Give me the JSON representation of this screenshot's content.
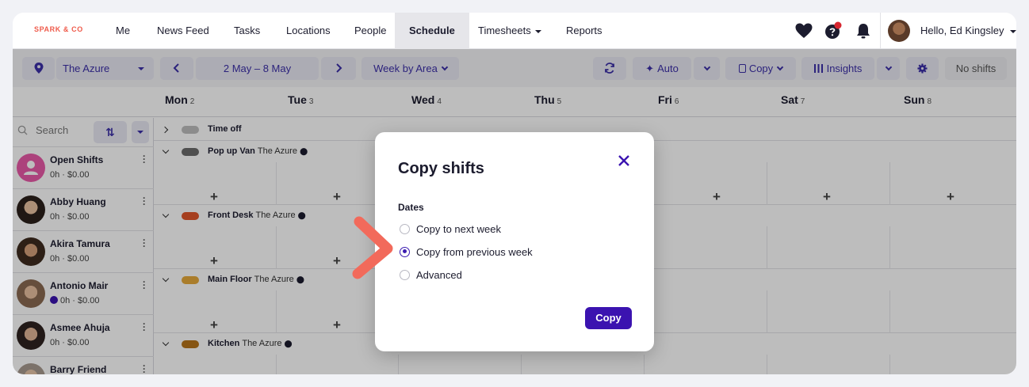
{
  "brand": "SPARK & CO",
  "nav": {
    "items": [
      {
        "label": "Me"
      },
      {
        "label": "News Feed"
      },
      {
        "label": "Tasks"
      },
      {
        "label": "Locations"
      },
      {
        "label": "People"
      },
      {
        "label": "Schedule"
      },
      {
        "label": "Timesheets"
      },
      {
        "label": "Reports"
      }
    ],
    "active": "Schedule",
    "greeting": "Hello, Ed Kingsley"
  },
  "toolbar": {
    "location": "The Azure",
    "date_range": "2 May – 8 May",
    "view": "Week by Area",
    "auto": "Auto",
    "copy": "Copy",
    "insights": "Insights",
    "no_shifts": "No shifts"
  },
  "days": [
    {
      "name": "Mon",
      "num": "2"
    },
    {
      "name": "Tue",
      "num": "3"
    },
    {
      "name": "Wed",
      "num": "4"
    },
    {
      "name": "Thu",
      "num": "5"
    },
    {
      "name": "Fri",
      "num": "6"
    },
    {
      "name": "Sat",
      "num": "7"
    },
    {
      "name": "Sun",
      "num": "8"
    }
  ],
  "sidebar": {
    "search_placeholder": "Search",
    "people": [
      {
        "name": "Open Shifts",
        "meta": "0h · $0.00"
      },
      {
        "name": "Abby Huang",
        "meta": "0h · $0.00"
      },
      {
        "name": "Akira Tamura",
        "meta": "0h · $0.00"
      },
      {
        "name": "Antonio Mair",
        "meta": "0h · $0.00"
      },
      {
        "name": "Asmee Ahuja",
        "meta": "0h · $0.00"
      },
      {
        "name": "Barry Friend",
        "meta": ""
      }
    ]
  },
  "areas": [
    {
      "name": "Time off",
      "location": "",
      "color": "#bdbdbd"
    },
    {
      "name": "Pop up Van",
      "location": "The Azure",
      "color": "#6b6b6b"
    },
    {
      "name": "Front Desk",
      "location": "The Azure",
      "color": "#e0552a"
    },
    {
      "name": "Main Floor",
      "location": "The Azure",
      "color": "#e6a93a"
    },
    {
      "name": "Kitchen",
      "location": "The Azure",
      "color": "#b5731a"
    }
  ],
  "modal": {
    "title": "Copy shifts",
    "section_label": "Dates",
    "options": [
      {
        "label": "Copy to next week",
        "selected": false
      },
      {
        "label": "Copy from previous week",
        "selected": true
      },
      {
        "label": "Advanced",
        "selected": false
      }
    ],
    "submit_label": "Copy"
  },
  "colors": {
    "accent": "#3b13b0",
    "brand": "#ef5b4b",
    "pointer": "#f26a5b"
  }
}
